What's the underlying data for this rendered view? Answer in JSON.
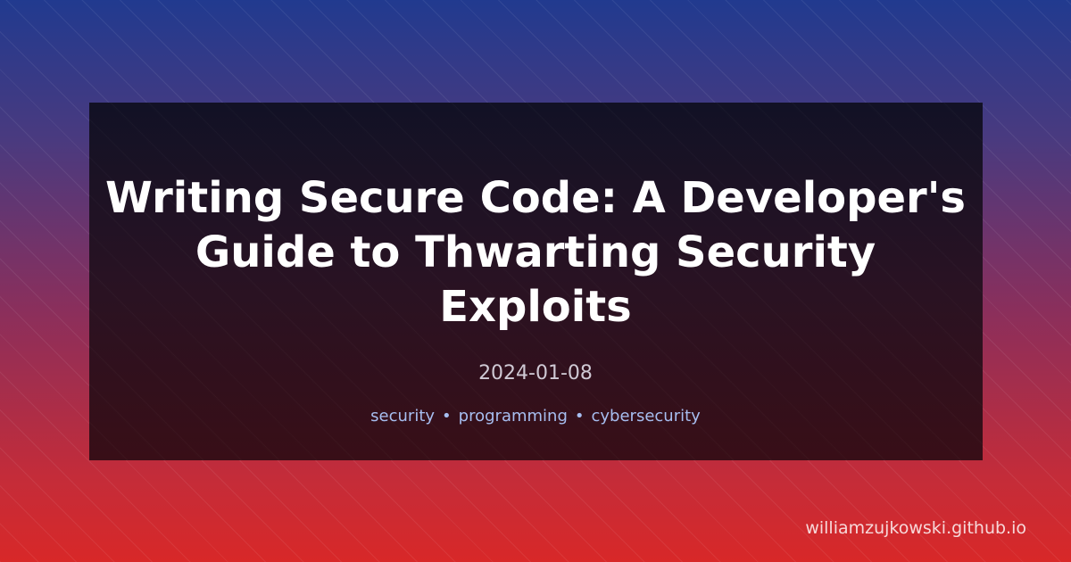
{
  "post": {
    "title": "Writing Secure Code: A Developer's Guide to Thwarting Security Exploits",
    "date": "2024-01-08",
    "tags": [
      "security",
      "programming",
      "cybersecurity"
    ],
    "tag_separator": "•"
  },
  "site": {
    "domain": "williamzujkowski.github.io"
  },
  "colors": {
    "gradient_top": "#213a8f",
    "gradient_bottom": "#d82828",
    "card_background": "#150f1e",
    "title_text": "#ffffff",
    "date_text": "#cfc9d4",
    "tags_text": "#a7bef0"
  }
}
